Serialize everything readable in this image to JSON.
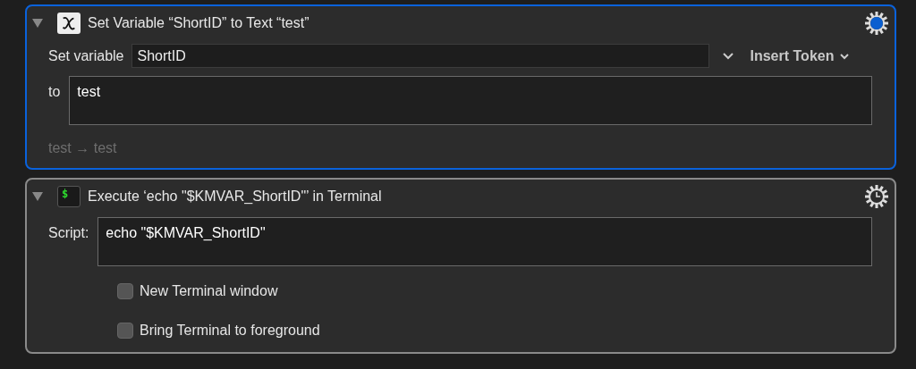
{
  "actions": [
    {
      "kind": "set_variable",
      "title": "Set Variable “ShortID” to Text “test”",
      "selected": true,
      "expanded": true,
      "gear_dot": true,
      "gear_clock": false,
      "variable_label": "Set variable",
      "variable_value": "ShortID",
      "insert_token": "Insert Token",
      "text_label": "to",
      "text_value": "test",
      "preview": "test → test"
    },
    {
      "kind": "execute_shell",
      "title": "Execute ‘echo \"$KMVAR_ShortID\"’ in Terminal",
      "selected": false,
      "expanded": true,
      "gear_dot": false,
      "gear_clock": true,
      "icon_glyph": "$",
      "script_label": "Script:",
      "script_value": "echo \"$KMVAR_ShortID\"",
      "options": [
        {
          "label": "New Terminal window",
          "checked": false
        },
        {
          "label": "Bring Terminal to foreground",
          "checked": false
        }
      ]
    }
  ]
}
